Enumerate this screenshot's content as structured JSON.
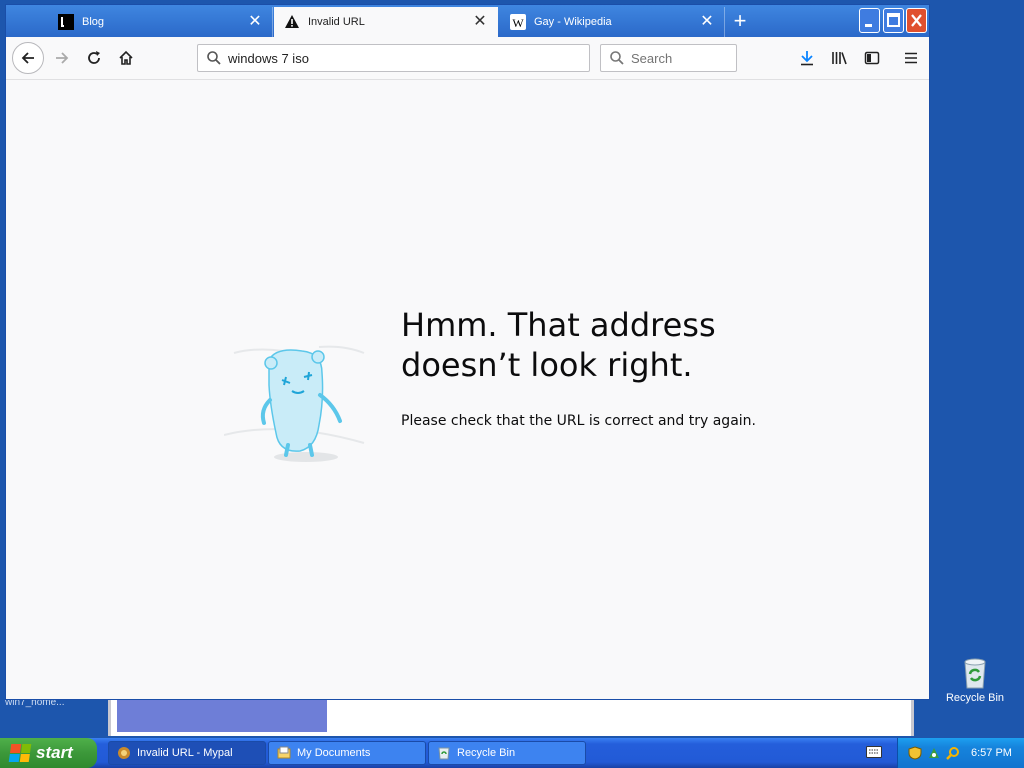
{
  "desktop": {
    "partial_label": "win7_home...",
    "recycle_bin_label": "Recycle Bin"
  },
  "browser": {
    "tabs": [
      {
        "title": "Blog",
        "active": false
      },
      {
        "title": "Invalid URL",
        "active": true
      },
      {
        "title": "Gay - Wikipedia",
        "active": false
      }
    ],
    "url_value": "windows 7 iso",
    "search_placeholder": "Search",
    "error": {
      "title": "Hmm. That address doesn’t look right.",
      "message": "Please check that the URL is correct and try again."
    }
  },
  "taskbar": {
    "start_label": "start",
    "buttons": [
      {
        "label": "Invalid URL - Mypal",
        "active": true
      },
      {
        "label": "My Documents",
        "active": false
      },
      {
        "label": "Recycle Bin",
        "active": false
      }
    ],
    "clock": "6:57 PM"
  },
  "colors": {
    "desktop": "#1d56ad",
    "tabbar": "#2b69c9",
    "close_button": "#e0502e",
    "mascot": "#8fd6ee"
  }
}
